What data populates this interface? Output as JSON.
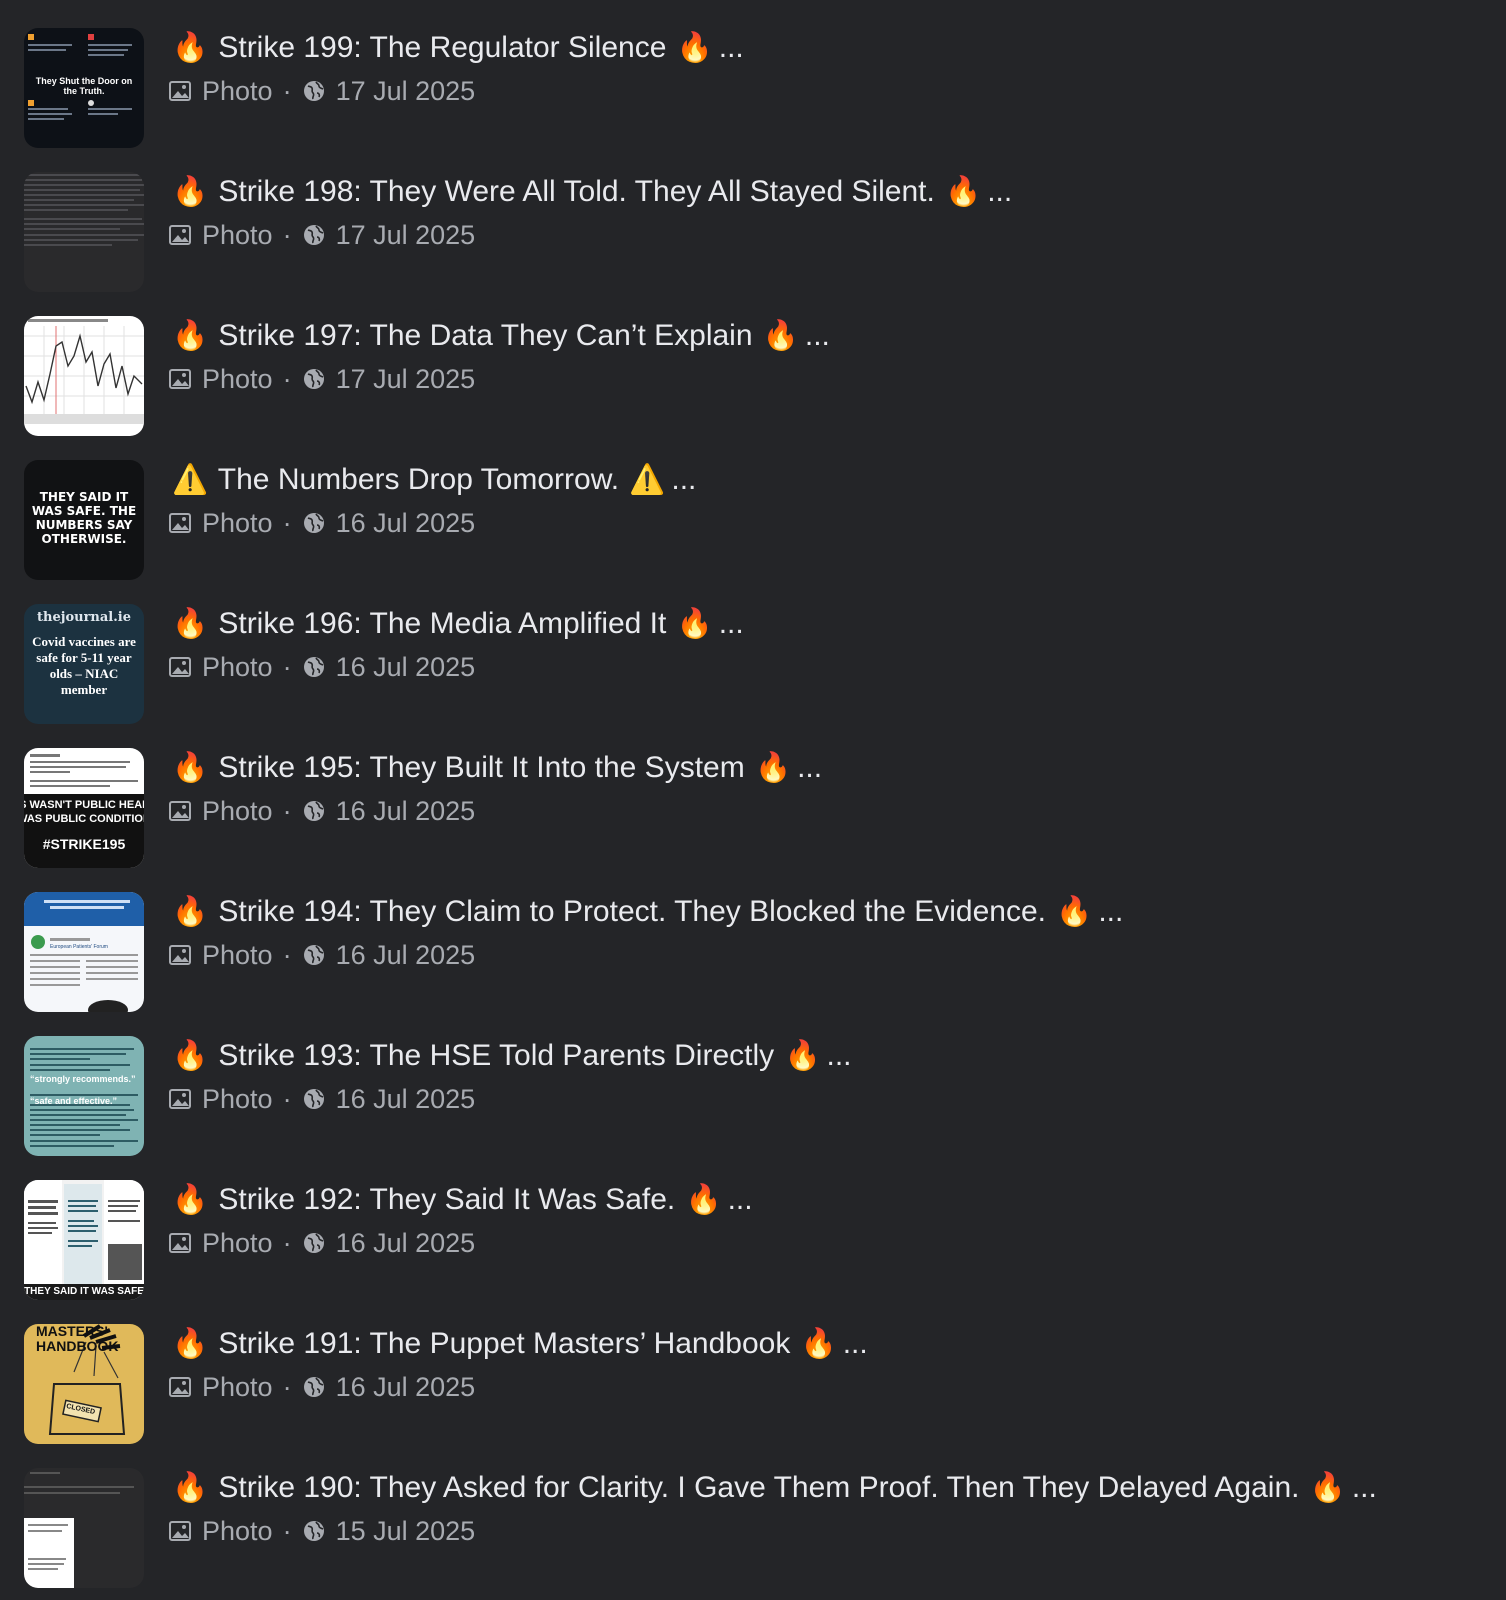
{
  "posts": [
    {
      "emoji": "🔥",
      "title": "Strike 199: The Regulator Silence",
      "type": "Photo",
      "date": "17 Jul 2025",
      "thumb_text": "They Shut the Door on the Truth."
    },
    {
      "emoji": "🔥",
      "title": "Strike 198: They Were All Told. They All Stayed Silent.",
      "type": "Photo",
      "date": "17 Jul 2025",
      "thumb_text": ""
    },
    {
      "emoji": "🔥",
      "title": "Strike 197: The Data They Can’t Explain",
      "type": "Photo",
      "date": "17 Jul 2025",
      "thumb_text": ""
    },
    {
      "emoji": "⚠️",
      "title": "The Numbers Drop Tomorrow.",
      "type": "Photo",
      "date": "16 Jul 2025",
      "thumb_text": "THEY SAID IT WAS SAFE. THE NUMBERS SAY OTHERWISE."
    },
    {
      "emoji": "🔥",
      "title": "Strike 196: The Media Amplified It",
      "type": "Photo",
      "date": "16 Jul 2025",
      "thumb_text": "Covid vaccines are safe for 5-11 year olds – NIAC member"
    },
    {
      "emoji": "🔥",
      "title": "Strike 195: They Built It Into the System",
      "type": "Photo",
      "date": "16 Jul 2025",
      "thumb_text": "#STRIKE195"
    },
    {
      "emoji": "🔥",
      "title": "Strike 194: They Claim to Protect. They Blocked the Evidence.",
      "type": "Photo",
      "date": "16 Jul 2025",
      "thumb_text": "European Patients' Forum"
    },
    {
      "emoji": "🔥",
      "title": "Strike 193: The HSE Told Parents Directly",
      "type": "Photo",
      "date": "16 Jul 2025",
      "thumb_text": "“strongly recommends.”"
    },
    {
      "emoji": "🔥",
      "title": "Strike 192: They Said It Was Safe.",
      "type": "Photo",
      "date": "16 Jul 2025",
      "thumb_text": "THEY SAID IT WAS SAFE"
    },
    {
      "emoji": "🔥",
      "title": "Strike 191: The Puppet Masters’ Handbook",
      "type": "Photo",
      "date": "16 Jul 2025",
      "thumb_text": "MASTERS' HANDBOOK"
    },
    {
      "emoji": "🔥",
      "title": "Strike 190: They Asked for Clarity. I Gave Them Proof. Then They Delayed Again.",
      "type": "Photo",
      "date": "15 Jul 2025",
      "thumb_text": ""
    }
  ],
  "ellipsis": "...",
  "separator": "·",
  "colors": {
    "background": "#242528",
    "title": "#e9eaee",
    "meta": "#a8abb1"
  }
}
